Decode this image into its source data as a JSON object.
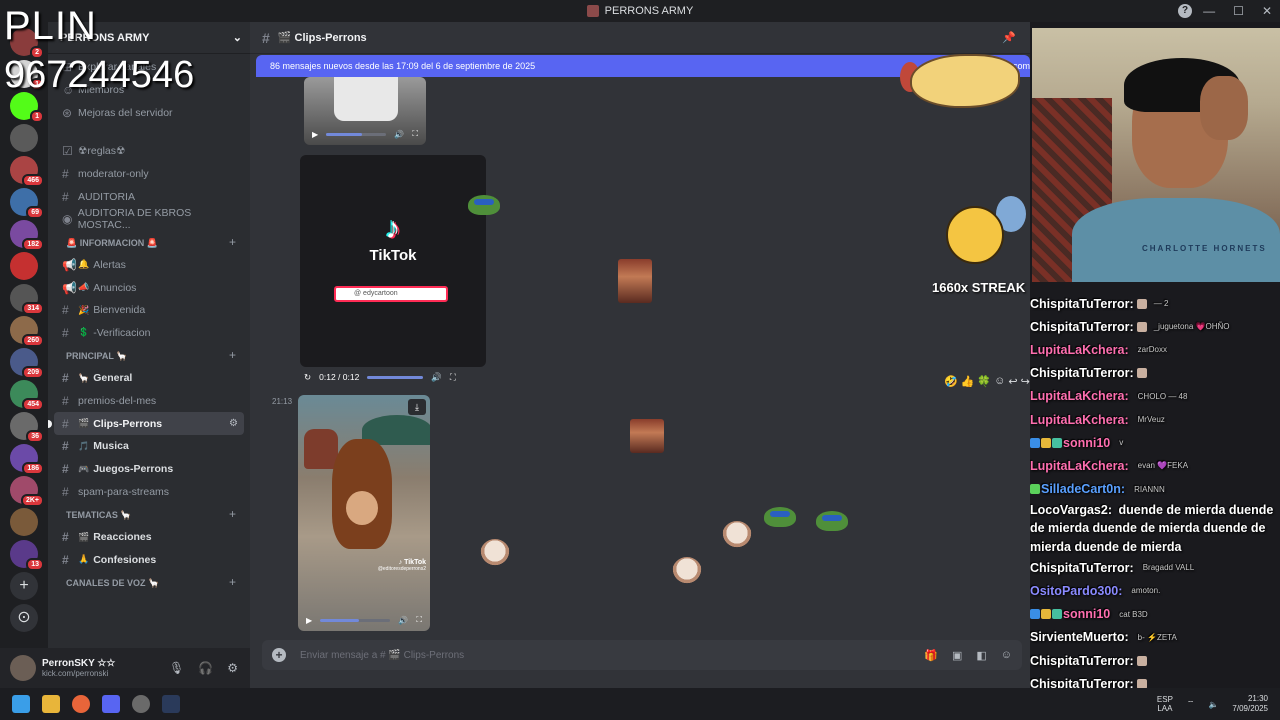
{
  "window": {
    "title": "PERRONS ARMY",
    "controls": [
      "—",
      "☐",
      "✕"
    ]
  },
  "rail": {
    "badges": [
      "2",
      "1",
      "466",
      "69",
      "182",
      "314",
      "260",
      "209",
      "454",
      "36",
      "186",
      "2K+",
      "13"
    ],
    "plus_icon": "+",
    "explore_icon": "⊙"
  },
  "sidebar": {
    "server_name": "PERRONS ARMY",
    "top_items": [
      {
        "prefix": "⊞",
        "label": "Explorar canales"
      },
      {
        "prefix": "☺",
        "label": "Miembros"
      },
      {
        "prefix": "⊛",
        "label": "Mejoras del servidor"
      }
    ],
    "channels_a": [
      {
        "prefix": "☑",
        "label": "☢reglas☢"
      },
      {
        "prefix": "#",
        "label": "moderator-only"
      },
      {
        "prefix": "#",
        "label": "AUDITORIA"
      },
      {
        "prefix": "◉",
        "label": "AUDITORIA DE KBROS MOSTAC..."
      }
    ],
    "cat_info": "🚨 INFORMACION 🚨",
    "channels_info": [
      {
        "prefix": "📢",
        "emo": "🔔",
        "label": "Alertas"
      },
      {
        "prefix": "📢",
        "emo": "📣",
        "label": "Anuncios"
      },
      {
        "prefix": "#",
        "emo": "🎉",
        "label": "Bienvenida"
      },
      {
        "prefix": "#",
        "emo": "💲",
        "label": "-Verificacion"
      }
    ],
    "cat_principal": "PRINCIPAL 🦙",
    "channels_principal": [
      {
        "prefix": "#",
        "emo": "🦙",
        "label": "General"
      },
      {
        "prefix": "#",
        "emo": "",
        "label": "premios-del-mes"
      },
      {
        "prefix": "#",
        "emo": "🎬",
        "label": "Clips-Perrons"
      },
      {
        "prefix": "#",
        "emo": "🎵",
        "label": "Musica"
      },
      {
        "prefix": "#",
        "emo": "🎮",
        "label": "Juegos-Perrons"
      },
      {
        "prefix": "#",
        "emo": "",
        "label": "spam-para-streams"
      }
    ],
    "cat_tematicas": "TEMATICAS 🦙",
    "channels_tematicas": [
      {
        "prefix": "#",
        "emo": "🎬",
        "label": "Reacciones"
      },
      {
        "prefix": "#",
        "emo": "🙏",
        "label": "Confesiones"
      }
    ],
    "cat_voz": "CANALES DE VOZ 🦙"
  },
  "user": {
    "name": "PerronSKY ☆☆",
    "status": "kick.com/perronski"
  },
  "main": {
    "channel_title": "🎬 Clips-Perrons",
    "new_messages": "86 mensajes nuevos desde las 17:09 del 6 de septiembre de 2025",
    "new_messages_tail": "r com",
    "tiktok_brand": "TikTok",
    "tiktok_search": "@ edycartoon",
    "player_time": "0:12 / 0:12",
    "player_progress": 1.0,
    "timestamp": "21:13",
    "tiktok_watermark": "♪ TikTok",
    "tiktok_handle": "@editoresdeperrons2",
    "composer_placeholder": "Enviar mensaje a # 🎬 Clips-Perrons"
  },
  "overlays": {
    "plin": "PLIN",
    "phone": "967244546",
    "streak": "1660x STREAK",
    "webcam_text": "CHARLOTTE HORNETS"
  },
  "chat": [
    {
      "user": "ChispitaTuTerror:",
      "color": "#ffffff",
      "msg": "",
      "side": "— 2"
    },
    {
      "user": "ChispitaTuTerror:",
      "color": "#ffffff",
      "msg": "",
      "side": "_juguetona 💗OHÑO"
    },
    {
      "user": "LupitaLaKchera:",
      "color": "#ff6fb0",
      "msg": "",
      "side": "zarDoxx"
    },
    {
      "user": "ChispitaTuTerror:",
      "color": "#ffffff",
      "msg": "",
      "side": ""
    },
    {
      "user": "LupitaLaKchera:",
      "color": "#ff6fb0",
      "msg": "",
      "side": "CHOLO — 48"
    },
    {
      "user": "LupitaLaKchera:",
      "color": "#ff6fb0",
      "msg": "",
      "side": "MrVeuz"
    },
    {
      "user": "sonni10",
      "color": "#ff6fb0",
      "msg": "",
      "side": "v"
    },
    {
      "user": "LupitaLaKchera:",
      "color": "#ff6fb0",
      "msg": "",
      "side": "evan 💜FEKA"
    },
    {
      "user": "SilladeCart0n:",
      "color": "#5aa0ff",
      "msg": "",
      "side": "RIANNN"
    },
    {
      "user": "LocoVargas2:",
      "color": "#ffffff",
      "msg": "duende de mierda duende de mierda duende de mierda duende de mierda duende de mierda",
      "side": ""
    },
    {
      "user": "ChispitaTuTerror:",
      "color": "#ffffff",
      "msg": "",
      "side": "Bragadd VALL"
    },
    {
      "user": "OsitoPardo300:",
      "color": "#8a8aff",
      "msg": "",
      "side": "amoton."
    },
    {
      "user": "sonni10",
      "color": "#ff6fb0",
      "msg": "",
      "side": "cat B3D"
    },
    {
      "user": "SirvienteMuerto:",
      "color": "#ffffff",
      "msg": "",
      "side": "b- ⚡ZETA"
    },
    {
      "user": "ChispitaTuTerror:",
      "color": "#ffffff",
      "msg": "",
      "side": ""
    },
    {
      "user": "ChispitaTuTerror:",
      "color": "#ffffff",
      "msg": "",
      "side": ""
    }
  ],
  "taskbar": {
    "lang_top": "ESP",
    "lang_bottom": "LAA",
    "time": "21:30",
    "date": "7/09/2025"
  },
  "colors": {
    "accent": "#5865f2",
    "sidebar_bg": "#2b2d31",
    "main_bg": "#313338",
    "badge_red": "#da373c"
  }
}
